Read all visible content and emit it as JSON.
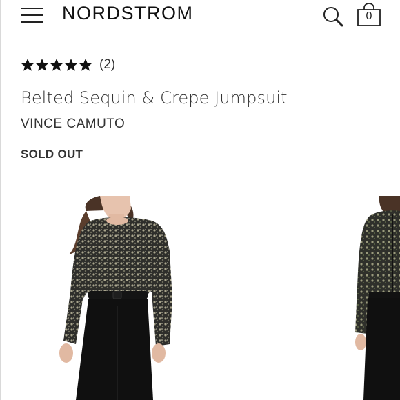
{
  "header": {
    "logo": "NORDSTROM",
    "bag_count": "0"
  },
  "product": {
    "rating_stars": 5,
    "review_count": "(2)",
    "title": "Belted Sequin & Crepe Jumpsuit",
    "brand": "VINCE CAMUTO",
    "status": "SOLD OUT"
  },
  "icons": {
    "menu": "hamburger-menu-icon",
    "search": "search-icon",
    "bag": "shopping-bag-icon",
    "star": "star-icon"
  },
  "colors": {
    "text": "#222222",
    "star": "#111111",
    "sequin_dark": "#2b2b29",
    "fabric_black": "#111111"
  },
  "gallery": {
    "images": [
      "front-view-photo",
      "back-view-photo"
    ]
  }
}
